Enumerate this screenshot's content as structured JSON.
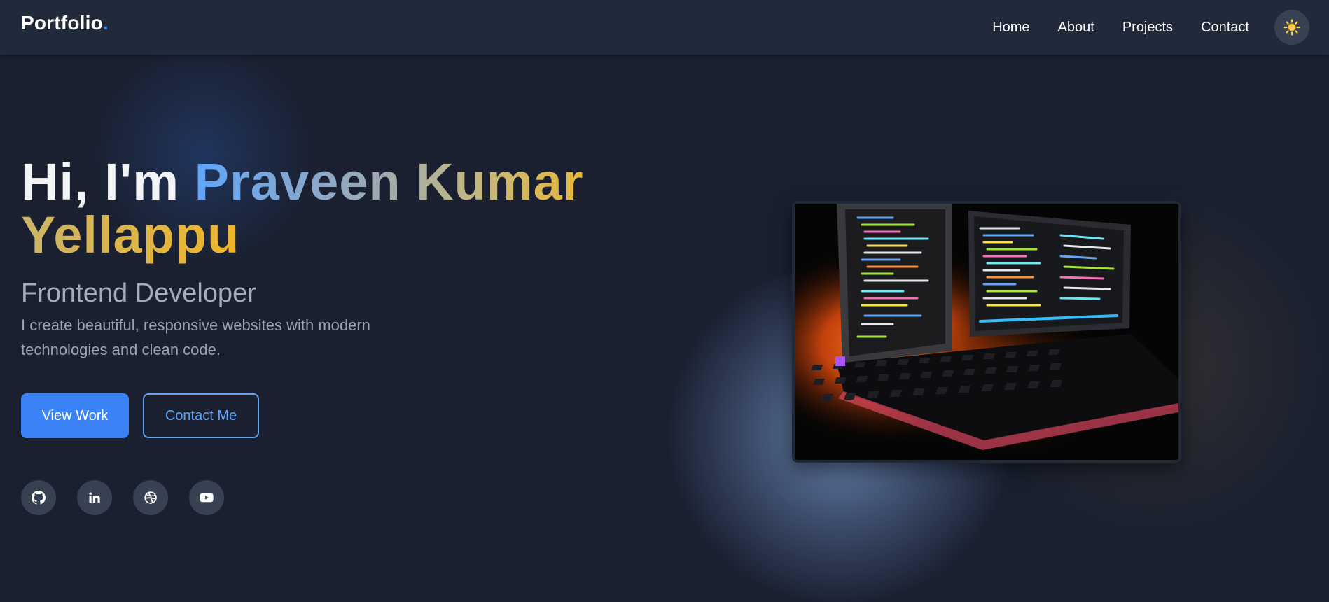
{
  "nav": {
    "logo_text": "Portfolio",
    "logo_dot": ".",
    "links": [
      "Home",
      "About",
      "Projects",
      "Contact"
    ],
    "theme_toggle_icon": "sun-icon"
  },
  "hero": {
    "greeting": "Hi, I'm",
    "name_line1": "Praveen Kumar",
    "name_line2": "Yellappu",
    "subtitle": "Frontend Developer",
    "description": "I create beautiful, responsive websites with modern technologies and clean code.",
    "buttons": {
      "primary": "View Work",
      "secondary": "Contact Me"
    },
    "socials": [
      "github-icon",
      "linkedin-icon",
      "dribbble-icon",
      "youtube-icon"
    ]
  },
  "image": {
    "subject": "keyboard-and-code-monitors"
  },
  "colors": {
    "background": "#1a2030",
    "navbar": "#212a3b",
    "accent": "#3b82f6",
    "accent_light": "#60a5fa",
    "gold": "#f0b429"
  }
}
